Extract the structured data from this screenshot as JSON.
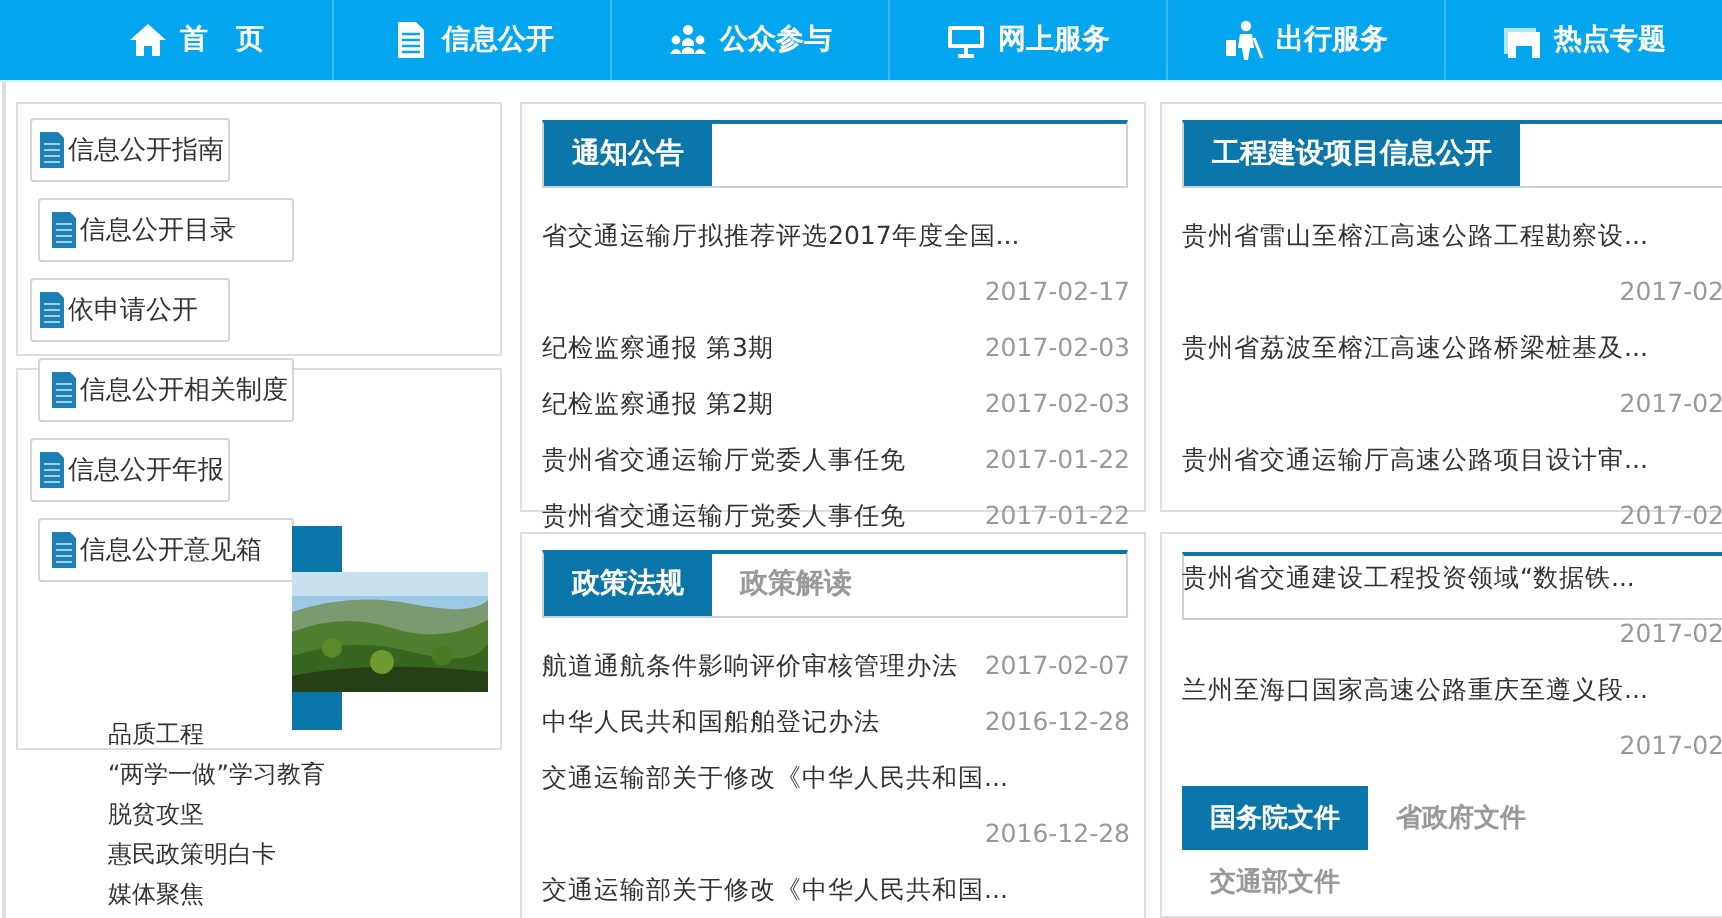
{
  "nav": [
    {
      "label": "首　页",
      "kind": "home"
    },
    {
      "label": "信息公开",
      "kind": "disclosure"
    },
    {
      "label": "公众参与",
      "kind": "participation"
    },
    {
      "label": "网上服务",
      "kind": "services"
    },
    {
      "label": "出行服务",
      "kind": "travel"
    },
    {
      "label": "热点专题",
      "kind": "topics"
    }
  ],
  "disclosure_buttons": [
    "信息公开指南",
    "信息公开目录",
    "依申请公开",
    "信息公开相关制度",
    "信息公开年报",
    "信息公开意见箱"
  ],
  "topic_links": [
    "品质工程",
    "“两学一做”学习教育",
    "脱贫攻坚",
    "惠民政策明白卡",
    "媒体聚焦"
  ],
  "notices": {
    "tabs": [
      {
        "label": "通知公告",
        "selected": true
      }
    ],
    "items": [
      {
        "title": "省交通运输厅拟推荐评选2017年度全国...",
        "date": "2017-02-17"
      },
      {
        "title": "纪检监察通报 第3期",
        "date": "2017-02-03"
      },
      {
        "title": "纪检监察通报 第2期",
        "date": "2017-02-03"
      },
      {
        "title": "贵州省交通运输厅党委人事任免",
        "date": "2017-01-22"
      },
      {
        "title": "贵州省交通运输厅党委人事任免",
        "date": "2017-01-22"
      }
    ]
  },
  "policies": {
    "tabs": [
      {
        "label": "政策法规",
        "selected": true
      },
      {
        "label": "政策解读",
        "selected": false
      }
    ],
    "items": [
      {
        "title": "航道通航条件影响评价审核管理办法",
        "date": "2017-02-07"
      },
      {
        "title": "中华人民共和国船舶登记办法",
        "date": "2016-12-28"
      },
      {
        "title": "交通运输部关于修改《中华人民共和国...",
        "date": "2016-12-28"
      },
      {
        "title": "交通运输部关于修改《中华人民共和国..."
      }
    ]
  },
  "projects": {
    "tabs": [
      {
        "label": "工程建设项目信息公开",
        "selected": true
      }
    ],
    "items": [
      {
        "title": "贵州省雷山至榕江高速公路工程勘察设...",
        "date": "2017-02"
      },
      {
        "title": "贵州省荔波至榕江高速公路桥梁桩基及...",
        "date": "2017-02"
      },
      {
        "title": "贵州省交通运输厅高速公路项目设计审...",
        "date": "2017-02"
      }
    ]
  },
  "documents": {
    "items": [
      {
        "title": "贵州省交通建设工程投资领域“数据铁...",
        "date": "2017-02"
      },
      {
        "title": "兰州至海口国家高速公路重庆至遵义段...",
        "date": "2017-02"
      }
    ],
    "tabs": [
      {
        "label": "国务院文件",
        "selected": true
      },
      {
        "label": "省政府文件",
        "selected": false
      },
      {
        "label": "交通部文件",
        "selected": false
      }
    ]
  }
}
